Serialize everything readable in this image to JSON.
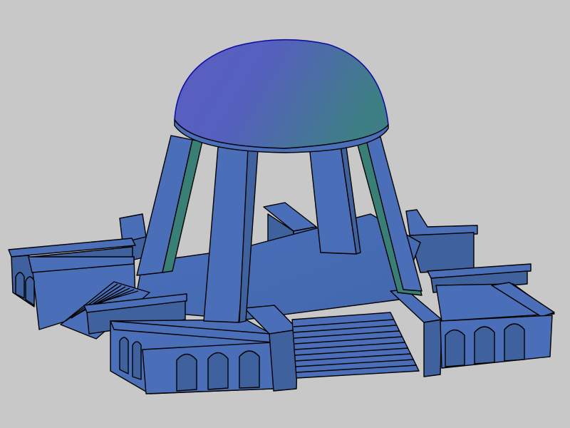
{
  "viewport": {
    "background_color": "#c8c8c8",
    "render_style": "shaded-3d-cad"
  },
  "model": {
    "colors": {
      "dome_light": "#5a5ec4",
      "dome_dark": "#3e7f86",
      "face_blue": "#4a6fb8",
      "face_dark": "#3f629f",
      "side_teal": "#3a7f76",
      "edge": "#000000",
      "dome_edge": "#1010a0"
    }
  }
}
